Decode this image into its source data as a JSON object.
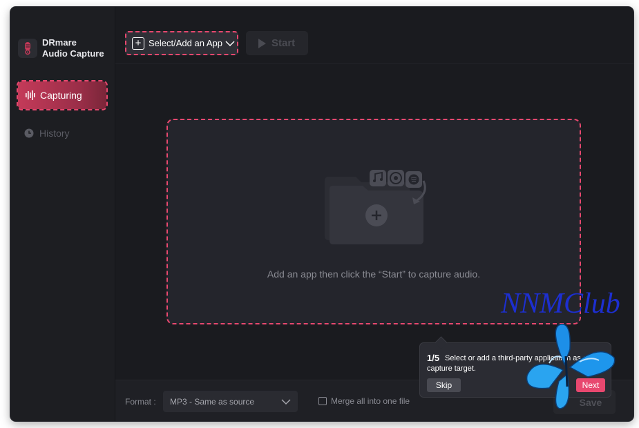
{
  "app": {
    "name_line1": "DRmare",
    "name_line2": "Audio Capture"
  },
  "sidebar": {
    "items": [
      {
        "label": "Capturing",
        "icon": "waveform-icon",
        "active": true
      },
      {
        "label": "History",
        "icon": "clock-icon",
        "active": false
      }
    ]
  },
  "toolbar": {
    "select_label": "Select/Add an App",
    "start_label": "Start"
  },
  "drop_zone": {
    "hint": "Add an app then click the “Start” to capture audio."
  },
  "footer": {
    "format_label": "Format :",
    "format_value": "MP3 - Same as source",
    "merge_label": "Merge all into one file",
    "merge_checked": false,
    "save_label": "Save"
  },
  "tooltip": {
    "step": "1/5",
    "message": "Select or add a third-party application as a capture target.",
    "skip_label": "Skip",
    "next_label": "Next"
  },
  "watermark": {
    "text": "NNMClub"
  },
  "colors": {
    "accent": "#e8486f",
    "background": "#1a1b1f",
    "sidebar": "#1d1e22",
    "watermark": "#1d2fd0"
  }
}
